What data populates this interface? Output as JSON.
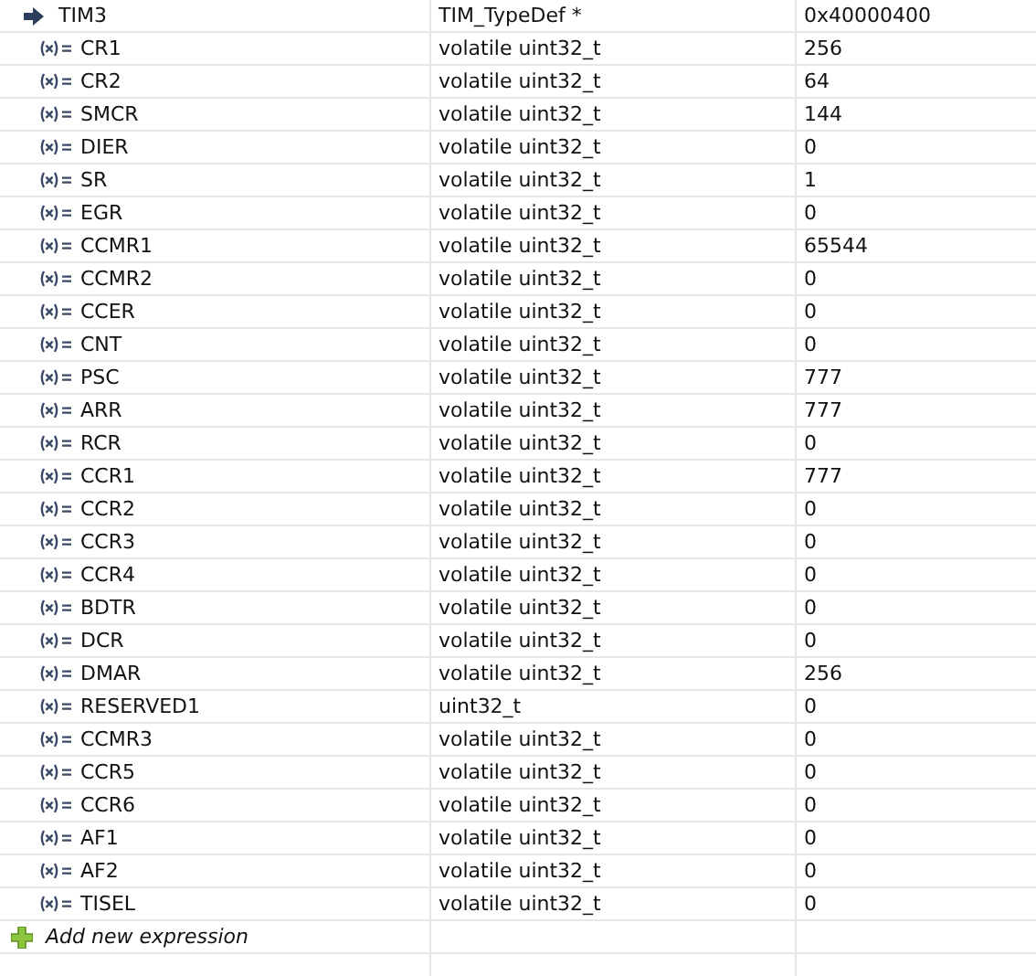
{
  "expressions": [
    {
      "name": "TIM3",
      "type": "TIM_TypeDef *",
      "value": "0x40000400",
      "children": [
        {
          "name": "CR1",
          "type": "volatile uint32_t",
          "value": "256"
        },
        {
          "name": "CR2",
          "type": "volatile uint32_t",
          "value": "64"
        },
        {
          "name": "SMCR",
          "type": "volatile uint32_t",
          "value": "144"
        },
        {
          "name": "DIER",
          "type": "volatile uint32_t",
          "value": "0"
        },
        {
          "name": "SR",
          "type": "volatile uint32_t",
          "value": "1"
        },
        {
          "name": "EGR",
          "type": "volatile uint32_t",
          "value": "0"
        },
        {
          "name": "CCMR1",
          "type": "volatile uint32_t",
          "value": "65544"
        },
        {
          "name": "CCMR2",
          "type": "volatile uint32_t",
          "value": "0"
        },
        {
          "name": "CCER",
          "type": "volatile uint32_t",
          "value": "0"
        },
        {
          "name": "CNT",
          "type": "volatile uint32_t",
          "value": "0"
        },
        {
          "name": "PSC",
          "type": "volatile uint32_t",
          "value": "777"
        },
        {
          "name": "ARR",
          "type": "volatile uint32_t",
          "value": "777"
        },
        {
          "name": "RCR",
          "type": "volatile uint32_t",
          "value": "0"
        },
        {
          "name": "CCR1",
          "type": "volatile uint32_t",
          "value": "777"
        },
        {
          "name": "CCR2",
          "type": "volatile uint32_t",
          "value": "0"
        },
        {
          "name": "CCR3",
          "type": "volatile uint32_t",
          "value": "0"
        },
        {
          "name": "CCR4",
          "type": "volatile uint32_t",
          "value": "0"
        },
        {
          "name": "BDTR",
          "type": "volatile uint32_t",
          "value": "0"
        },
        {
          "name": "DCR",
          "type": "volatile uint32_t",
          "value": "0"
        },
        {
          "name": "DMAR",
          "type": "volatile uint32_t",
          "value": "256"
        },
        {
          "name": "RESERVED1",
          "type": "uint32_t",
          "value": "0"
        },
        {
          "name": "CCMR3",
          "type": "volatile uint32_t",
          "value": "0"
        },
        {
          "name": "CCR5",
          "type": "volatile uint32_t",
          "value": "0"
        },
        {
          "name": "CCR6",
          "type": "volatile uint32_t",
          "value": "0"
        },
        {
          "name": "AF1",
          "type": "volatile uint32_t",
          "value": "0"
        },
        {
          "name": "AF2",
          "type": "volatile uint32_t",
          "value": "0"
        },
        {
          "name": "TISEL",
          "type": "volatile uint32_t",
          "value": "0"
        }
      ]
    }
  ],
  "add_row": {
    "label": "Add new expression"
  }
}
